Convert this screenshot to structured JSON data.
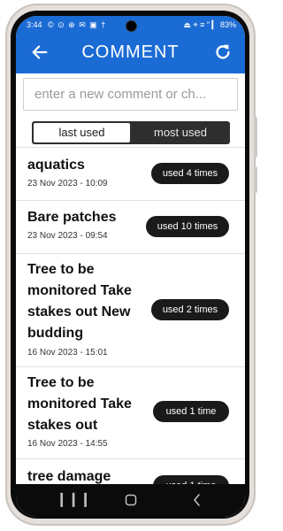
{
  "status": {
    "time": "3:44",
    "left_icons": "© ⊙ ⊕ ✉ ▣ †",
    "right_icons": "⏏ ⌖ ≡ ″ ▎",
    "battery": "83%"
  },
  "header": {
    "title": "COMMENT",
    "back_icon": "arrow-left",
    "refresh_icon": "refresh"
  },
  "comment_input": {
    "placeholder": "enter a new comment or ch..."
  },
  "tabs": [
    {
      "label": "last used",
      "active": true
    },
    {
      "label": "most used",
      "active": false
    }
  ],
  "comments": [
    {
      "text": "aquatics",
      "date": "23 Nov 2023 - 10:09",
      "usage": "used 4 times"
    },
    {
      "text": "Bare patches",
      "date": "23 Nov 2023 - 09:54",
      "usage": "used 10 times"
    },
    {
      "text": "Tree to be monitored Take stakes out New budding",
      "date": "16 Nov 2023 - 15:01",
      "usage": "used 2 times"
    },
    {
      "text": "Tree to be monitored Take stakes out",
      "date": "16 Nov 2023 - 14:55",
      "usage": "used 1 time"
    },
    {
      "text": "tree damage",
      "date": "",
      "usage": "used 1 time"
    }
  ],
  "colors": {
    "header_bg": "#1b6bd4",
    "badge_bg": "#1a1a1a",
    "segment_bg": "#2e2e2e"
  }
}
